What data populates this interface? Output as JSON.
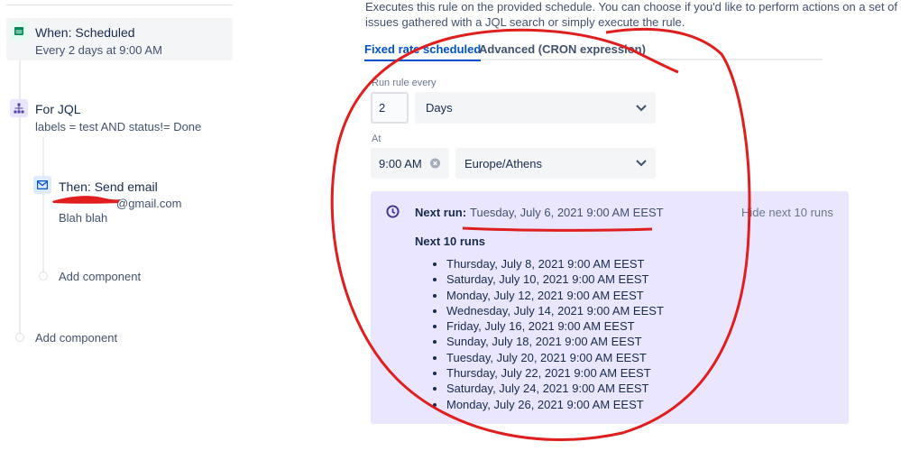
{
  "sidebar": {
    "trigger": {
      "title": "When: Scheduled",
      "subtitle": "Every 2 days at 9:00 AM"
    },
    "branch": {
      "title": "For JQL",
      "subtitle": "labels = test AND status!= Done"
    },
    "action": {
      "title": "Then: Send email",
      "email": "@gmail.com",
      "body": "Blah blah"
    },
    "inner_add": "Add component",
    "outer_add": "Add component"
  },
  "main": {
    "description_1": "Executes this rule on the provided schedule. You can choose if you'd like to perform actions on a set of",
    "description_2": "issues gathered with a JQL search or simply execute the rule.",
    "tabs": [
      {
        "label": "Fixed rate scheduled",
        "active": true
      },
      {
        "label": "Advanced (CRON expression)",
        "active": false
      }
    ],
    "run_every_label": "Run rule every",
    "interval_value": "2",
    "interval_unit": "Days",
    "at_label": "At",
    "time_value": "9:00 AM",
    "timezone": "Europe/Athens",
    "next_run_label": "Next run:",
    "next_run_value": "Tuesday, July 6, 2021 9:00 AM EEST",
    "hide_link": "Hide next 10 runs",
    "next_runs_title": "Next 10 runs",
    "next_runs": [
      "Thursday, July 8, 2021 9:00 AM EEST",
      "Saturday, July 10, 2021 9:00 AM EEST",
      "Monday, July 12, 2021 9:00 AM EEST",
      "Wednesday, July 14, 2021 9:00 AM EEST",
      "Friday, July 16, 2021 9:00 AM EEST",
      "Sunday, July 18, 2021 9:00 AM EEST",
      "Tuesday, July 20, 2021 9:00 AM EEST",
      "Thursday, July 22, 2021 9:00 AM EEST",
      "Saturday, July 24, 2021 9:00 AM EEST",
      "Monday, July 26, 2021 9:00 AM EEST"
    ]
  },
  "colors": {
    "accent": "#0052cc",
    "panel": "#eae6ff",
    "annotation": "#e01e1e"
  }
}
